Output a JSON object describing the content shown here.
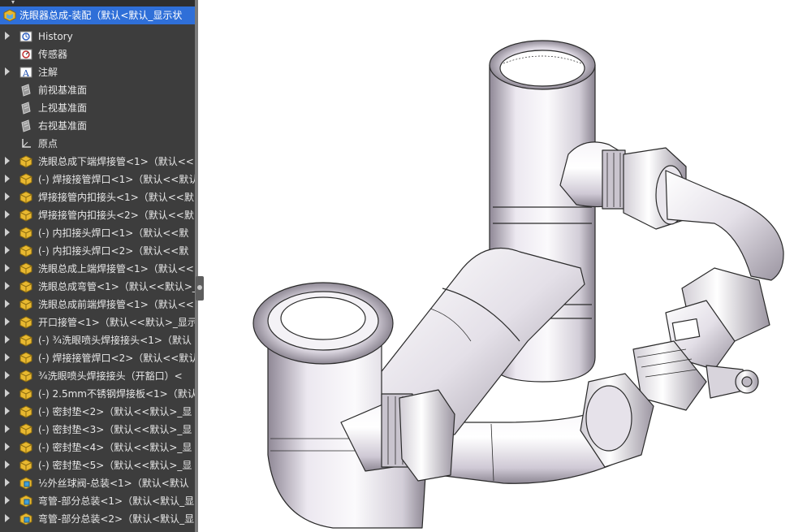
{
  "tree": {
    "root": {
      "label": "洗眼器总成-装配（默认<默认_显示状"
    },
    "items": [
      {
        "label": "History",
        "icon": "history-icon",
        "expandable": true
      },
      {
        "label": "传感器",
        "icon": "sensor-icon",
        "expandable": false
      },
      {
        "label": "注解",
        "icon": "annotation-icon",
        "expandable": true
      },
      {
        "label": "前视基准面",
        "icon": "plane-icon",
        "expandable": false
      },
      {
        "label": "上视基准面",
        "icon": "plane-icon",
        "expandable": false
      },
      {
        "label": "右视基准面",
        "icon": "plane-icon",
        "expandable": false
      },
      {
        "label": "原点",
        "icon": "origin-icon",
        "expandable": false
      },
      {
        "label": "洗眼总成下端焊接管<1>（默认<<",
        "icon": "part-icon",
        "expandable": true
      },
      {
        "label": "(-) 焊接接管焊口<1>（默认<<默认",
        "icon": "part-icon",
        "expandable": true
      },
      {
        "label": "焊接接管内扣接头<1>（默认<<默",
        "icon": "part-icon",
        "expandable": true
      },
      {
        "label": "焊接接管内扣接头<2>（默认<<默",
        "icon": "part-icon",
        "expandable": true
      },
      {
        "label": "(-) 内扣接头焊口<1>（默认<<默",
        "icon": "part-icon",
        "expandable": true
      },
      {
        "label": "(-) 内扣接头焊口<2>（默认<<默",
        "icon": "part-icon",
        "expandable": true
      },
      {
        "label": "洗眼总成上端焊接管<1>（默认<<",
        "icon": "part-icon",
        "expandable": true
      },
      {
        "label": "洗眼总成弯管<1>（默认<<默认>_",
        "icon": "part-icon",
        "expandable": true
      },
      {
        "label": "洗眼总成前端焊接管<1>（默认<<",
        "icon": "part-icon",
        "expandable": true
      },
      {
        "label": "开口接管<1>（默认<<默认>_显示",
        "icon": "part-icon",
        "expandable": true
      },
      {
        "label": "(-) ¾洗眼喷头焊接接头<1>（默认",
        "icon": "part-icon",
        "expandable": true
      },
      {
        "label": "(-) 焊接接管焊口<2>（默认<<默认",
        "icon": "part-icon",
        "expandable": true
      },
      {
        "label": "¾洗眼喷头焊接接头（开豁口）<",
        "icon": "part-icon",
        "expandable": true
      },
      {
        "label": "(-) 2.5mm不锈钢焊接板<1>（默认",
        "icon": "part-icon",
        "expandable": true
      },
      {
        "label": "(-) 密封垫<2>（默认<<默认>_显",
        "icon": "part-icon",
        "expandable": true
      },
      {
        "label": "(-) 密封垫<3>（默认<<默认>_显",
        "icon": "part-icon",
        "expandable": true
      },
      {
        "label": "(-) 密封垫<4>（默认<<默认>_显",
        "icon": "part-icon",
        "expandable": true
      },
      {
        "label": "(-) 密封垫<5>（默认<<默认>_显",
        "icon": "part-icon",
        "expandable": true
      },
      {
        "label": "½外丝球阀-总装<1>（默认<默认",
        "icon": "assembly-icon",
        "expandable": true
      },
      {
        "label": "弯管-部分总装<1>（默认<默认_显",
        "icon": "assembly-icon",
        "expandable": true
      },
      {
        "label": "弯管-部分总装<2>（默认<默认_显",
        "icon": "assembly-icon",
        "expandable": true
      }
    ]
  },
  "colors": {
    "panel_bg": "#3d3d3d",
    "selection": "#2f6fd8",
    "part_icon": "#e8b830",
    "model_light": "#f4f0f6",
    "model_shade": "#8a8490"
  },
  "viewport": {
    "content": "3d-model-eyewash-pipe-assembly"
  }
}
